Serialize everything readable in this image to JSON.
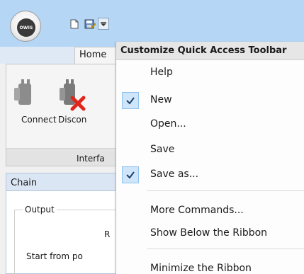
{
  "toolbar": {
    "orb_text": "OWIS",
    "icons": [
      "app-orb-icon",
      "new-document-icon",
      "save-as-icon",
      "customize-dropdown-icon"
    ]
  },
  "tabs": {
    "home": "Home"
  },
  "ribbon": {
    "connect_label": "Connect",
    "disconnect_label": "Discon",
    "group_label": "Interfa"
  },
  "chain": {
    "header": "Chain",
    "output_label": "Output",
    "r_label": "R",
    "start_label": "Start from po"
  },
  "menu": {
    "title": "Customize Quick Access Toolbar",
    "items": [
      {
        "label": "Help",
        "checked": false
      },
      {
        "label": "New",
        "checked": true
      },
      {
        "label": "Open...",
        "checked": false
      },
      {
        "label": "Save",
        "checked": false
      },
      {
        "label": "Save as...",
        "checked": true
      },
      {
        "label": "More Commands...",
        "checked": false
      },
      {
        "label": "Show Below the Ribbon",
        "checked": false
      },
      {
        "label": "Minimize the Ribbon",
        "checked": false
      }
    ]
  },
  "colors": {
    "titlebar": "#b5d6f5",
    "check_bg": "#cfe5fa",
    "check_border": "#90c1ef",
    "disconnect_accent": "#e0251b"
  }
}
